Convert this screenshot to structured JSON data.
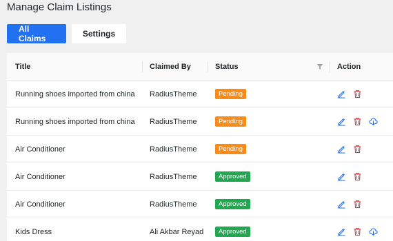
{
  "page_title": "Manage Claim Listings",
  "tabs": [
    {
      "label": "All Claims",
      "active": true
    },
    {
      "label": "Settings",
      "active": false
    }
  ],
  "table": {
    "columns": [
      "Title",
      "Claimed By",
      "Status",
      "Action"
    ],
    "rows": [
      {
        "title": "Running shoes imported from china",
        "claimed_by": "RadiusTheme",
        "status": "Pending",
        "actions": [
          "edit",
          "delete"
        ]
      },
      {
        "title": "Running shoes imported from china",
        "claimed_by": "RadiusTheme",
        "status": "Pending",
        "actions": [
          "edit",
          "delete",
          "download"
        ]
      },
      {
        "title": "Air Conditioner",
        "claimed_by": "RadiusTheme",
        "status": "Pending",
        "actions": [
          "edit",
          "delete"
        ]
      },
      {
        "title": "Air Conditioner",
        "claimed_by": "RadiusTheme",
        "status": "Approved",
        "actions": [
          "edit",
          "delete"
        ]
      },
      {
        "title": "Air Conditioner",
        "claimed_by": "RadiusTheme",
        "status": "Approved",
        "actions": [
          "edit",
          "delete"
        ]
      },
      {
        "title": "Kids Dress",
        "claimed_by": "Ali Akbar Reyad",
        "status": "Approved",
        "actions": [
          "edit",
          "delete",
          "download"
        ]
      }
    ]
  },
  "colors": {
    "primary": "#2271f1",
    "pending": "#f78c1a",
    "approved": "#1fa84f",
    "delete": "#d63638",
    "edit": "#2271f1"
  },
  "icons": {
    "filter": "filter-icon",
    "edit": "pencil-icon",
    "delete": "trash-icon",
    "download": "cloud-download-icon"
  }
}
